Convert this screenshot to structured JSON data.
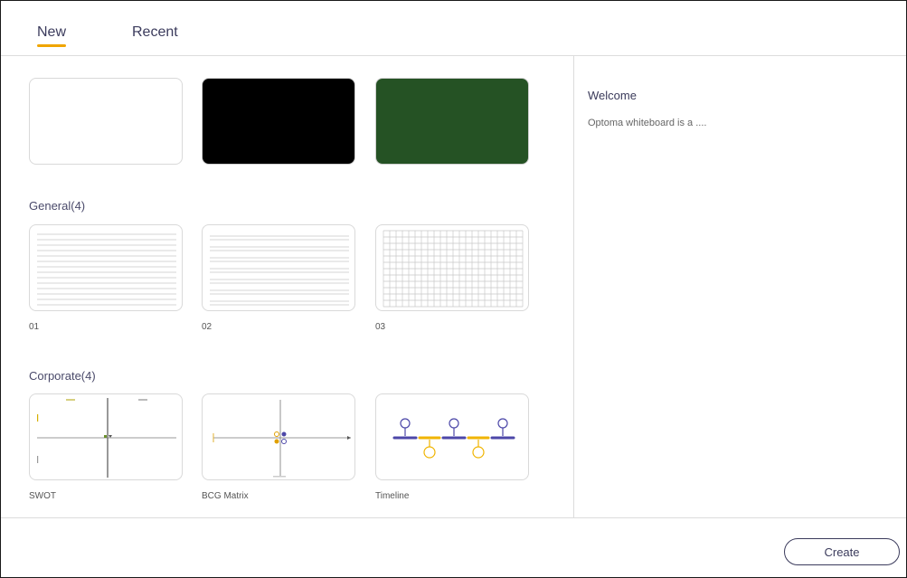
{
  "tabs": [
    {
      "label": "New",
      "active": true
    },
    {
      "label": "Recent",
      "active": false
    }
  ],
  "colors": {
    "accent_underline": "#f0a500",
    "board_white": "#ffffff",
    "board_black": "#000000",
    "board_green": "#255224",
    "diagram_purple": "#4c47a8",
    "diagram_yellow": "#f0b400"
  },
  "boards": [
    {
      "name": "white-board"
    },
    {
      "name": "black-board"
    },
    {
      "name": "green-board"
    }
  ],
  "general": {
    "title": "General(4)",
    "templates": [
      {
        "label": "01",
        "icon": "lined-paper-icon"
      },
      {
        "label": "02",
        "icon": "lined-paper-icon"
      },
      {
        "label": "03",
        "icon": "grid-paper-icon"
      }
    ]
  },
  "corporate": {
    "title": "Corporate(4)",
    "templates": [
      {
        "label": "SWOT",
        "icon": "swot-diagram-icon"
      },
      {
        "label": "BCG Matrix",
        "icon": "bcg-matrix-icon"
      },
      {
        "label": "Timeline",
        "icon": "timeline-diagram-icon"
      }
    ]
  },
  "details": {
    "title": "Welcome",
    "description": "Optoma whiteboard is a ...."
  },
  "footer": {
    "create_label": "Create"
  }
}
